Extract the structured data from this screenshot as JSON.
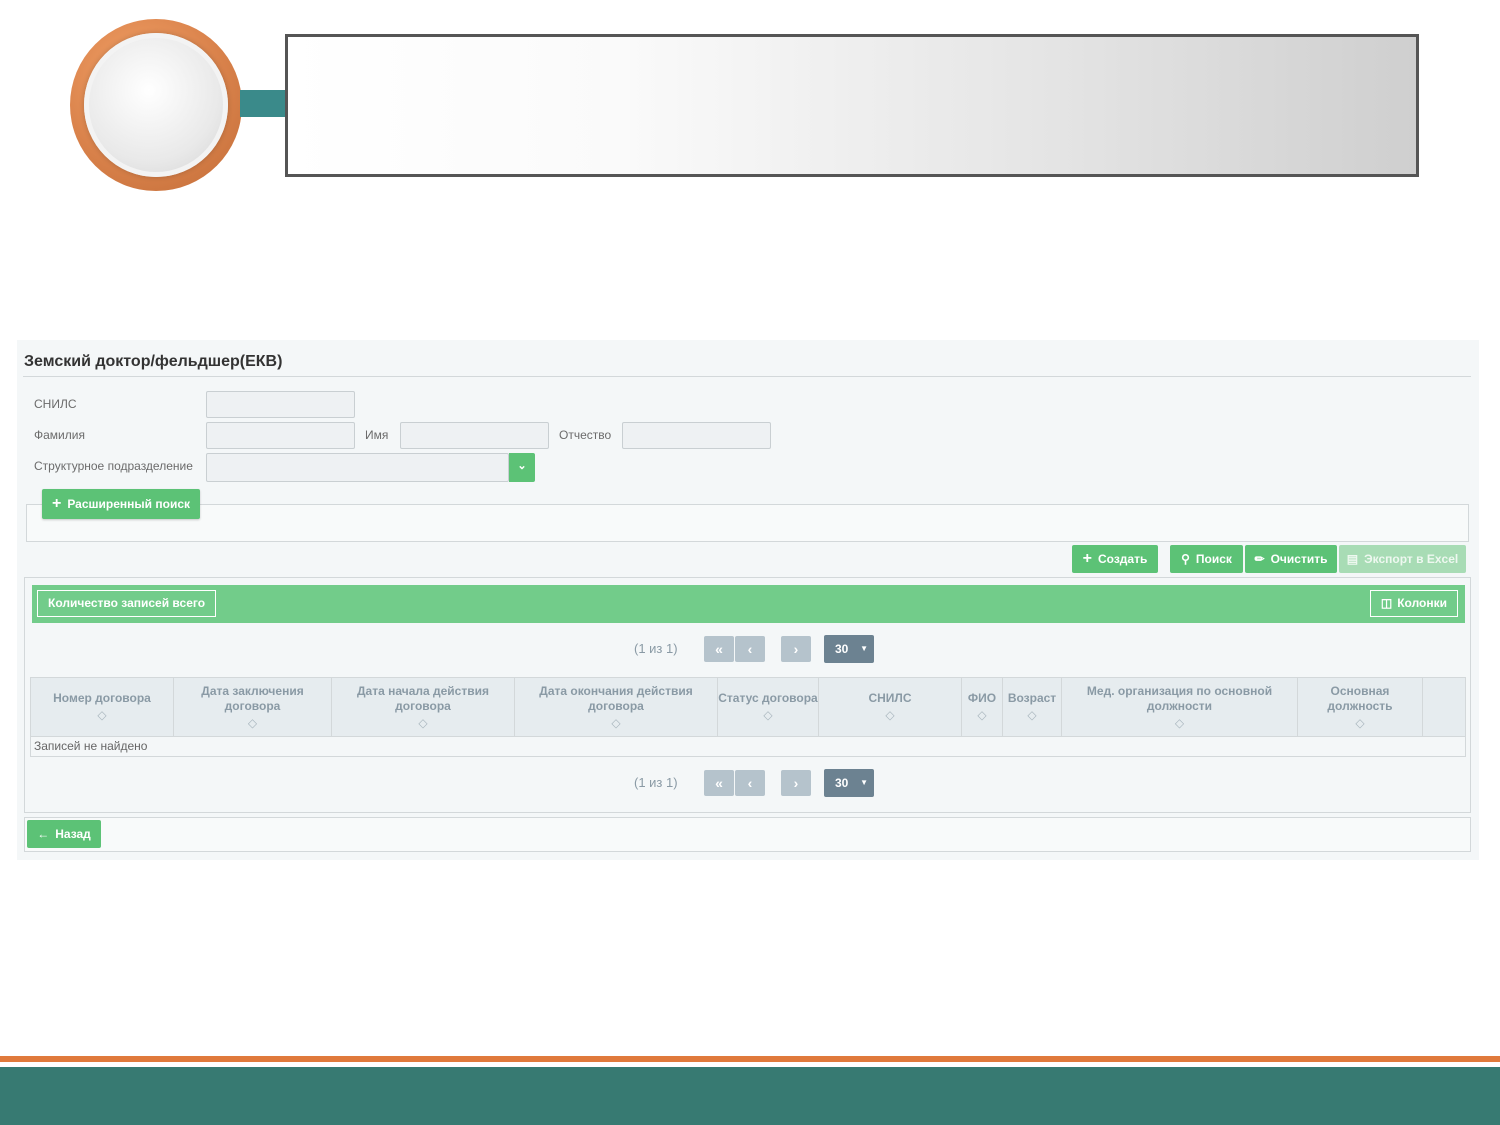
{
  "page": {
    "title": "Земский доктор/фельдшер(ЕКВ)"
  },
  "filters": {
    "snils_label": "СНИЛС",
    "lastname_label": "Фамилия",
    "firstname_label": "Имя",
    "patronymic_label": "Отчество",
    "department_label": "Структурное подразделение",
    "snils_value": "",
    "lastname_value": "",
    "firstname_value": "",
    "patronymic_value": "",
    "department_value": ""
  },
  "advanced_search": {
    "label": "Расширенный поиск"
  },
  "toolbar": {
    "create_label": "Создать",
    "search_label": "Поиск",
    "clear_label": "Очистить",
    "export_label": "Экспорт в Excel"
  },
  "grid": {
    "count_label": "Количество записей всего",
    "columns_label": "Колонки",
    "pager_info": "(1 из 1)",
    "page_size": "30",
    "columns": [
      "Номер договора",
      "Дата заключения договора",
      "Дата начала действия договора",
      "Дата окончания действия договора",
      "Статус договора",
      "СНИЛС",
      "ФИО",
      "Возраст",
      "Мед. организация по основной должности",
      "Основная должность"
    ],
    "empty_text": "Записей не найдено"
  },
  "footer": {
    "back_label": "Назад"
  },
  "colors": {
    "primary_green": "#5cc276",
    "header_green": "#72cc8a",
    "slide_teal": "#377a72",
    "slide_orange": "#e07a3c"
  }
}
